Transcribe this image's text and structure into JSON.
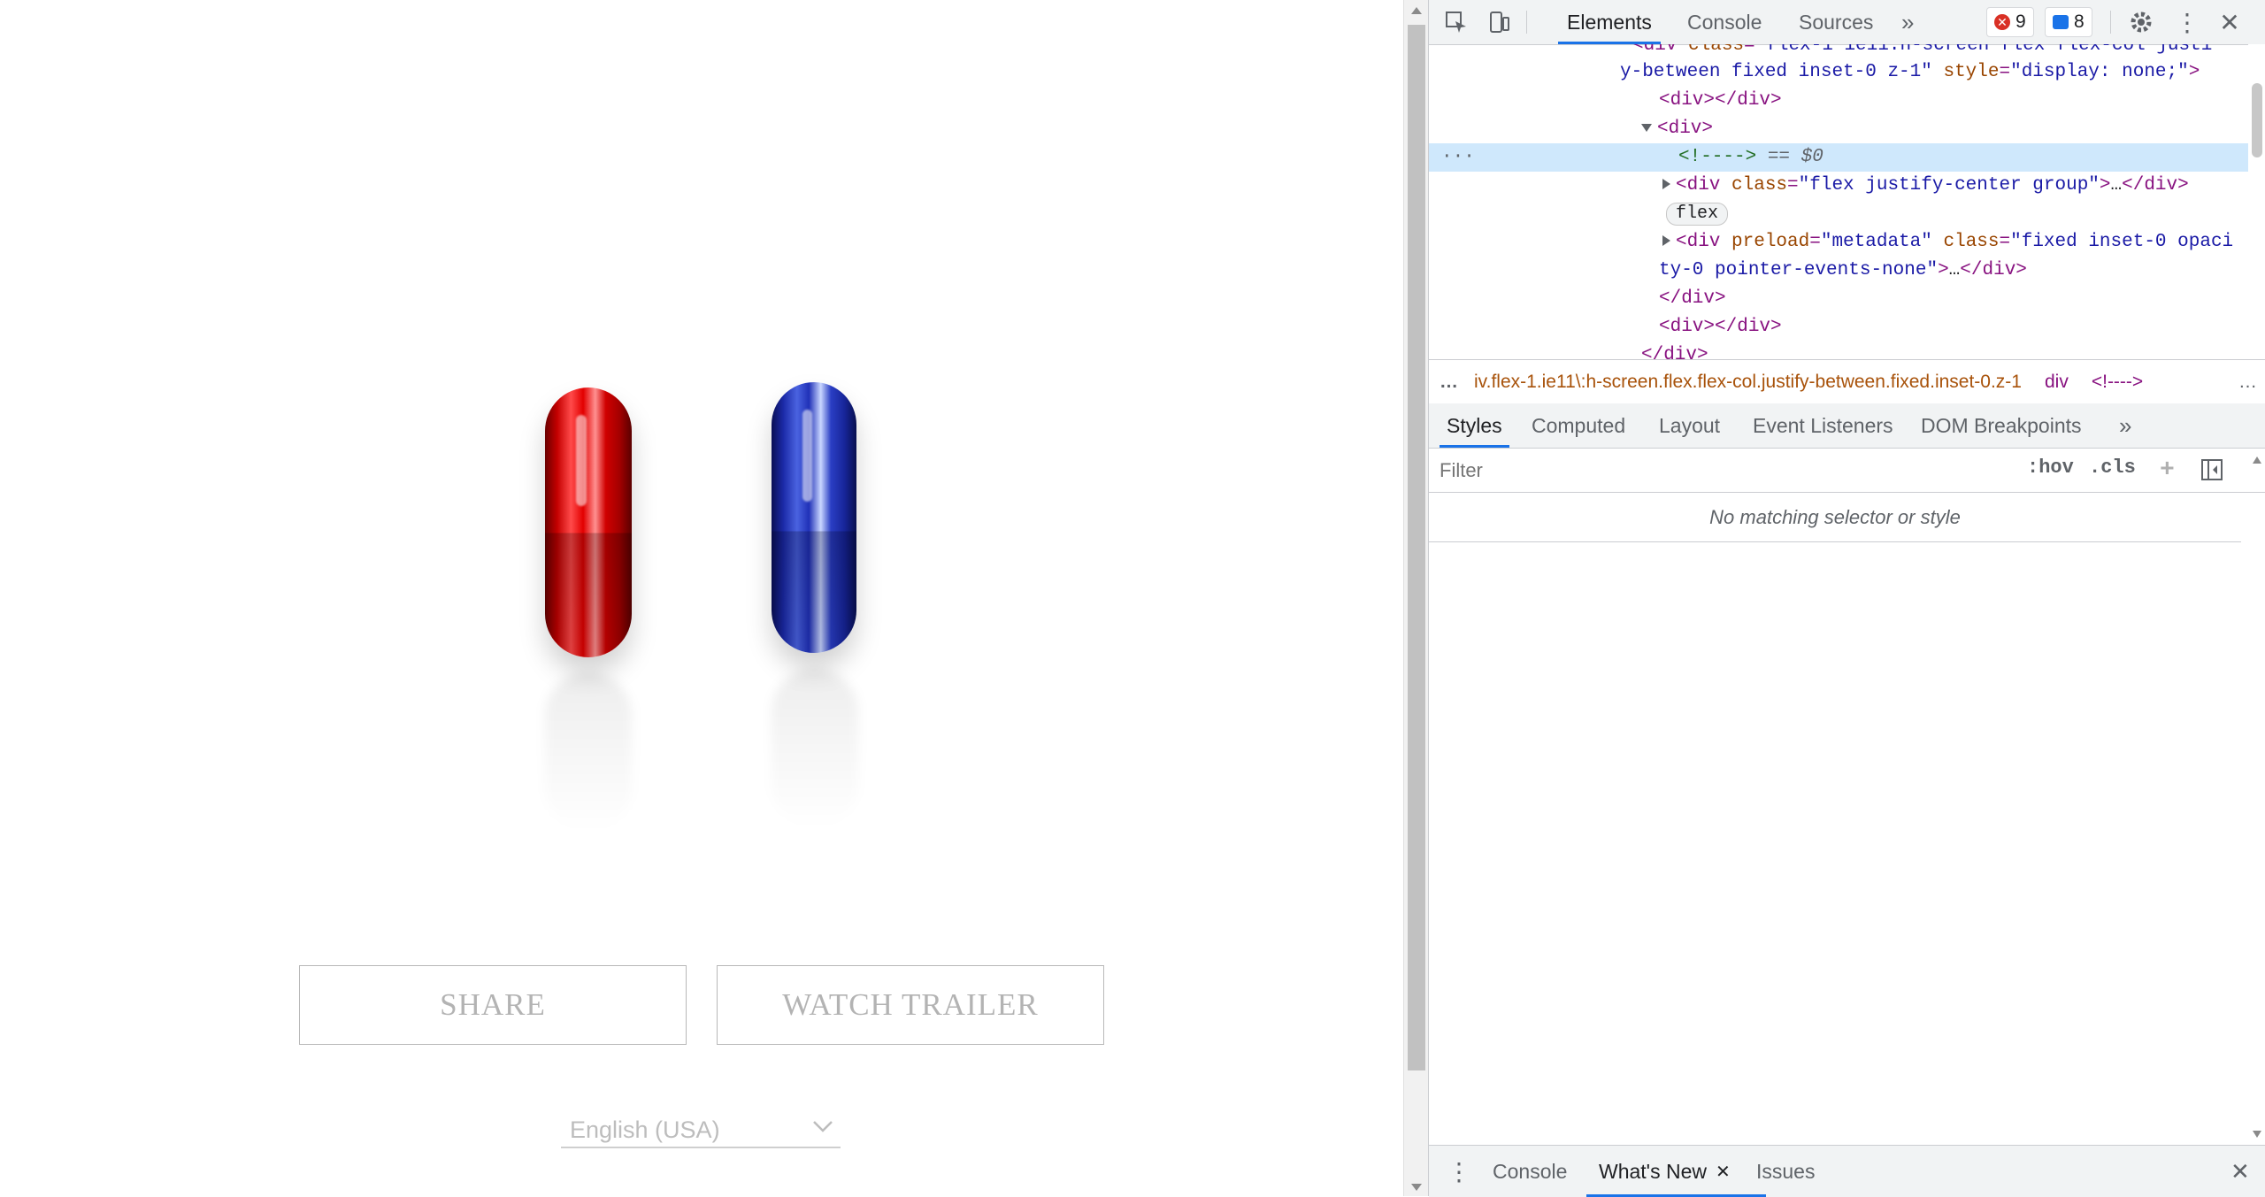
{
  "page": {
    "share_label": "SHARE",
    "trailer_label": "WATCH TRAILER",
    "language": "English (USA)"
  },
  "devtools": {
    "tabs": [
      "Elements",
      "Console",
      "Sources"
    ],
    "errors_count": "9",
    "messages_count": "8",
    "elements_lines": [
      {
        "pre": "<div class=",
        "attrval": "\"flex-1 ie11:h-screen flex flex-col justi"
      },
      {
        "text": "y-between fixed inset-0 z-1\" style=\"display: none;\">"
      },
      {
        "text": "<div></div>"
      },
      {
        "text": "<div>"
      },
      {
        "comment": "<!---->",
        "eq": " == $0"
      },
      {
        "text": "<div class=\"flex justify-center group\">…</div>"
      },
      {
        "badge": "flex"
      },
      {
        "text": "<div preload=\"metadata\" class=\"fixed inset-0 opaci"
      },
      {
        "text": "ty-0 pointer-events-none\">…</div>"
      },
      {
        "text": "</div>"
      },
      {
        "text": "<div></div>"
      },
      {
        "text": "</div>"
      }
    ],
    "breadcrumb_path": "iv.flex-1.ie11\\:h-screen.flex.flex-col.justify-between.fixed.inset-0.z-1",
    "breadcrumb_div": "div",
    "breadcrumb_comment": "<!---->",
    "styles_tabs": [
      "Styles",
      "Computed",
      "Layout",
      "Event Listeners",
      "DOM Breakpoints"
    ],
    "filter_placeholder": "Filter",
    "hov_label": ":hov",
    "cls_label": ".cls",
    "no_match": "No matching selector or style",
    "drawer_tabs": [
      "Console",
      "What's New",
      "Issues"
    ]
  }
}
